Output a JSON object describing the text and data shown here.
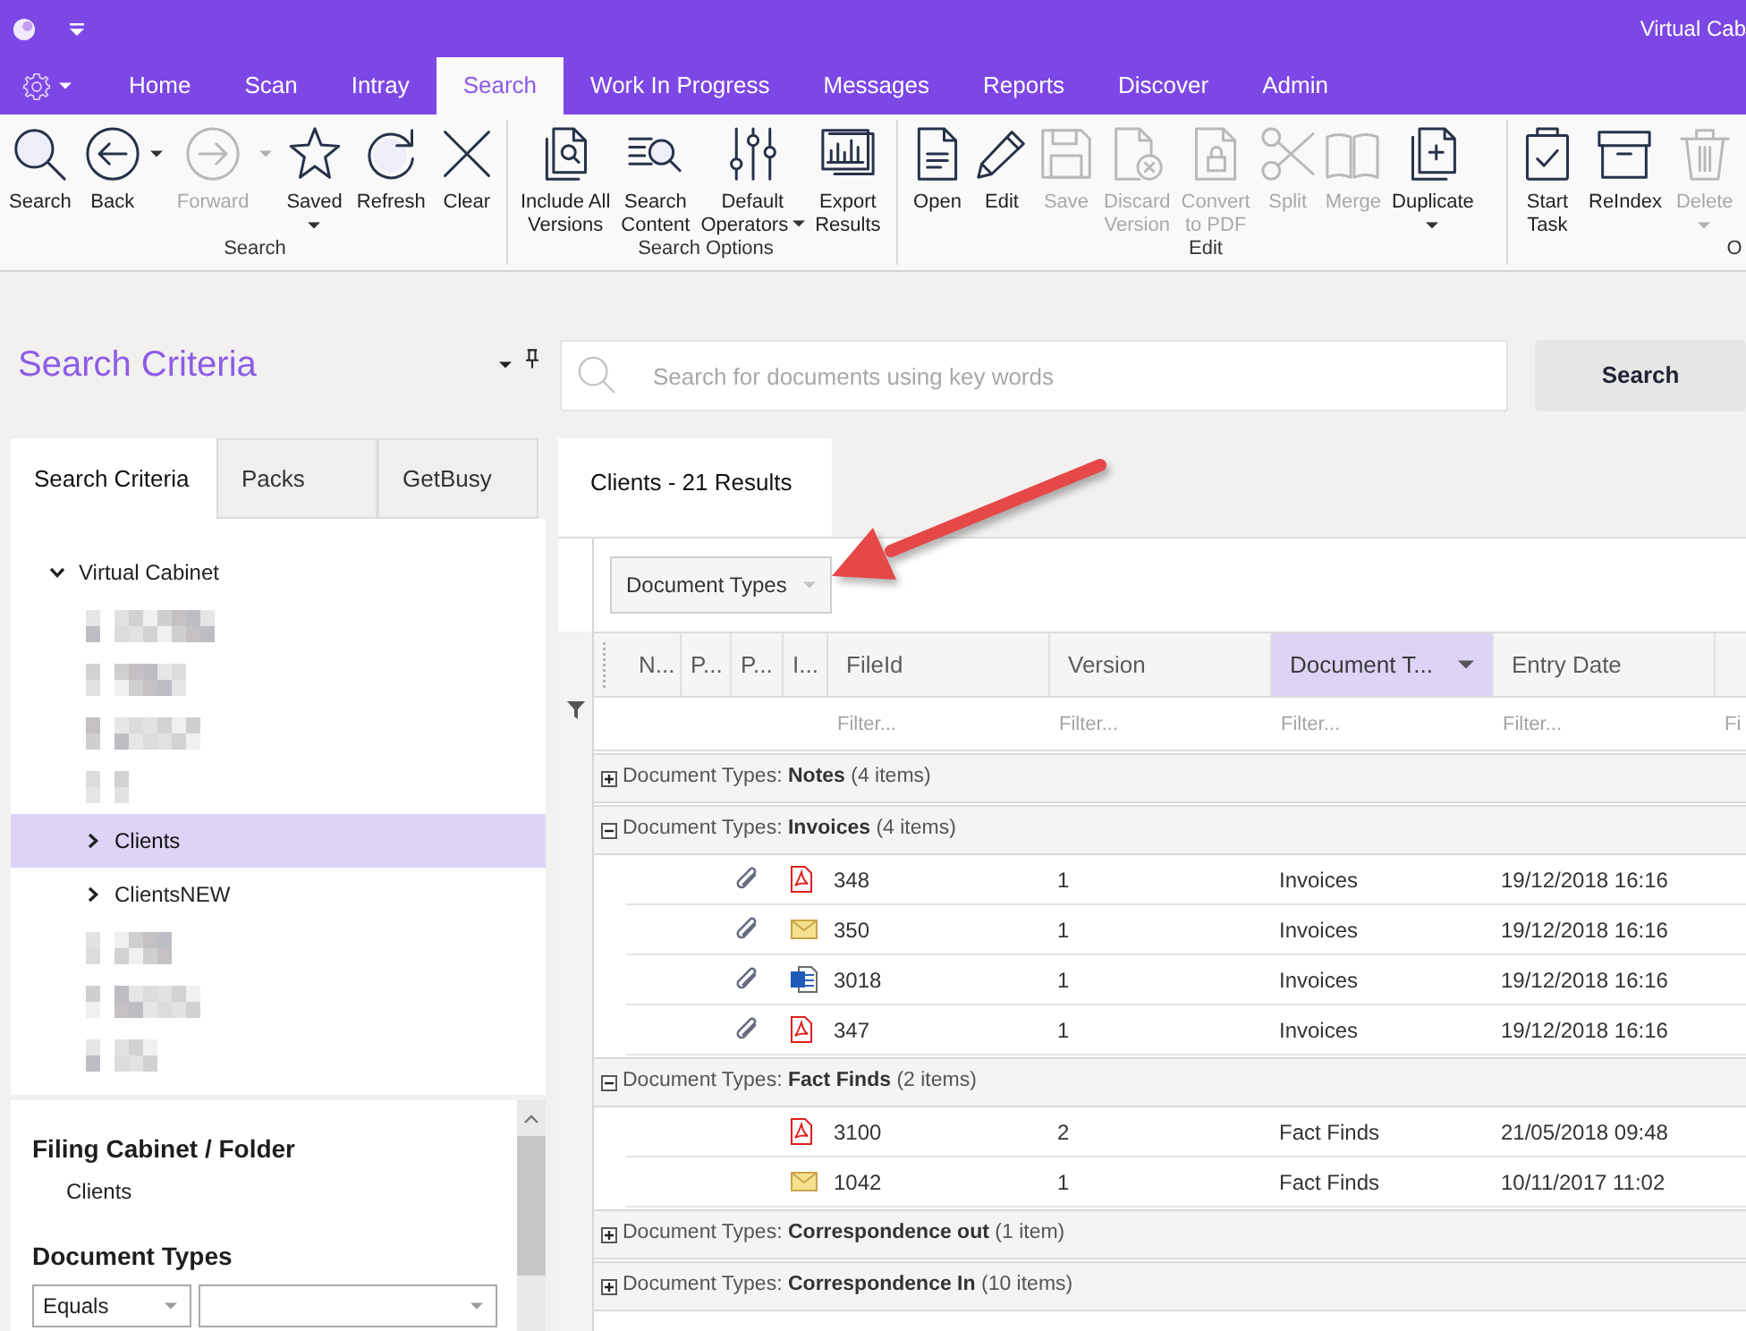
{
  "title_bar": {
    "title": "Virtual Cab"
  },
  "menu_tabs": [
    {
      "label": "Home",
      "selected": false
    },
    {
      "label": "Scan",
      "selected": false
    },
    {
      "label": "Intray",
      "selected": false
    },
    {
      "label": "Search",
      "selected": true
    },
    {
      "label": "Work In Progress",
      "selected": false
    },
    {
      "label": "Messages",
      "selected": false
    },
    {
      "label": "Reports",
      "selected": false
    },
    {
      "label": "Discover",
      "selected": false
    },
    {
      "label": "Admin",
      "selected": false
    }
  ],
  "ribbon": {
    "groups": [
      {
        "label": "Search",
        "buttons": [
          {
            "kind": "search",
            "label": "Search",
            "disabled": false
          },
          {
            "kind": "back",
            "label": "Back",
            "disabled": false,
            "dropdown": true,
            "split": true
          },
          {
            "kind": "forward",
            "label": "Forward",
            "disabled": true,
            "dropdown": true,
            "split": true
          },
          {
            "kind": "star",
            "label": "Saved",
            "disabled": false,
            "dropdown": true
          },
          {
            "kind": "refresh",
            "label": "Refresh",
            "disabled": false
          },
          {
            "kind": "clear",
            "label": "Clear",
            "disabled": false
          }
        ]
      },
      {
        "label": "Search Options",
        "buttons": [
          {
            "kind": "versions",
            "label": "Include All\nVersions",
            "disabled": false
          },
          {
            "kind": "content",
            "label": "Search\nContent",
            "disabled": false
          },
          {
            "kind": "operators",
            "label": "Default\nOperators",
            "disabled": false,
            "dropdown": true
          },
          {
            "kind": "export",
            "label": "Export\nResults",
            "disabled": false
          }
        ]
      },
      {
        "label": "Edit",
        "buttons": [
          {
            "kind": "open",
            "label": "Open",
            "disabled": false
          },
          {
            "kind": "edit",
            "label": "Edit",
            "disabled": false
          },
          {
            "kind": "save",
            "label": "Save",
            "disabled": true
          },
          {
            "kind": "discard",
            "label": "Discard\nVersion",
            "disabled": true
          },
          {
            "kind": "convert",
            "label": "Convert\nto PDF",
            "disabled": true
          },
          {
            "kind": "split",
            "label": "Split",
            "disabled": true
          },
          {
            "kind": "merge",
            "label": "Merge",
            "disabled": true
          },
          {
            "kind": "duplicate",
            "label": "Duplicate",
            "disabled": false,
            "dropdown": true
          }
        ]
      },
      {
        "label": "O",
        "buttons": [
          {
            "kind": "task",
            "label": "Start\nTask",
            "disabled": false
          },
          {
            "kind": "reindex",
            "label": "ReIndex",
            "disabled": false
          },
          {
            "kind": "delete",
            "label": "Delete",
            "disabled": true,
            "dropdown": true
          }
        ]
      }
    ]
  },
  "search_panel": {
    "title": "Search Criteria",
    "tabs": [
      {
        "label": "Search Criteria",
        "selected": true
      },
      {
        "label": "Packs",
        "selected": false
      },
      {
        "label": "GetBusy",
        "selected": false
      }
    ],
    "tree": [
      {
        "kind": "folder",
        "label": "Virtual Cabinet",
        "expanded": true,
        "selected": false,
        "children": [
          {
            "kind": "redacted",
            "selected": false
          },
          {
            "kind": "redacted",
            "selected": false
          },
          {
            "kind": "redacted",
            "selected": false
          },
          {
            "kind": "redacted",
            "selected": false
          },
          {
            "kind": "folder",
            "label": "Clients",
            "expanded": false,
            "selected": true
          },
          {
            "kind": "folder",
            "label": "ClientsNEW",
            "expanded": false,
            "selected": false
          },
          {
            "kind": "redacted",
            "selected": false
          },
          {
            "kind": "redacted",
            "selected": false
          },
          {
            "kind": "redacted",
            "selected": false
          }
        ]
      }
    ],
    "filing_cabinet": {
      "heading": "Filing Cabinet / Folder",
      "value": "Clients"
    },
    "document_types": {
      "heading": "Document Types",
      "operator": "Equals"
    }
  },
  "search_bar": {
    "placeholder": "Search for documents using key words",
    "button": "Search"
  },
  "results_tab": {
    "label": "Clients - 21 Results",
    "selected": true
  },
  "grid": {
    "group_by": [
      {
        "label": "Document Types"
      }
    ],
    "columns": [
      {
        "label": "N...",
        "selected": false
      },
      {
        "label": "P...",
        "selected": false
      },
      {
        "label": "P...",
        "selected": false
      },
      {
        "label": "I...",
        "selected": false
      },
      {
        "label": "FileId",
        "selected": false,
        "filter": {
          "placeholder": "Filter..."
        }
      },
      {
        "label": "Version",
        "selected": false,
        "filter": {
          "placeholder": "Filter..."
        }
      },
      {
        "label": "Document T...",
        "selected": true,
        "filter": {
          "placeholder": "Filter..."
        }
      },
      {
        "label": "Entry Date",
        "selected": false,
        "filter": {
          "placeholder": "Filter..."
        }
      },
      {
        "selected": false,
        "filter": {
          "placeholder": "Fi"
        }
      }
    ],
    "groups": [
      {
        "label": "Document Types: **Notes** (4 items)",
        "expanded": false
      },
      {
        "label": "Document Types: **Invoices** (4 items)",
        "expanded": true,
        "rows": [
          {
            "kind": "pdf",
            "attachment": true,
            "file_id": "348",
            "version": "1",
            "document_type": "Invoices",
            "entry_date": "19/12/2018 16:16"
          },
          {
            "kind": "email",
            "attachment": true,
            "file_id": "350",
            "version": "1",
            "document_type": "Invoices",
            "entry_date": "19/12/2018 16:16"
          },
          {
            "kind": "word",
            "attachment": true,
            "file_id": "3018",
            "version": "1",
            "document_type": "Invoices",
            "entry_date": "19/12/2018 16:16"
          },
          {
            "kind": "pdf",
            "attachment": true,
            "file_id": "347",
            "version": "1",
            "document_type": "Invoices",
            "entry_date": "19/12/2018 16:16"
          }
        ]
      },
      {
        "label": "Document Types: **Fact Finds** (2 items)",
        "expanded": true,
        "rows": [
          {
            "kind": "pdf",
            "attachment": false,
            "file_id": "3100",
            "version": "2",
            "document_type": "Fact Finds",
            "entry_date": "21/05/2018 09:48"
          },
          {
            "kind": "email",
            "attachment": false,
            "file_id": "1042",
            "version": "1",
            "document_type": "Fact Finds",
            "entry_date": "10/11/2017 11:02"
          }
        ]
      },
      {
        "label": "Document Types: **Correspondence out** (1 item)",
        "expanded": false
      },
      {
        "label": "Document Types: **Correspondence In** (10 items)",
        "expanded": false
      }
    ]
  }
}
